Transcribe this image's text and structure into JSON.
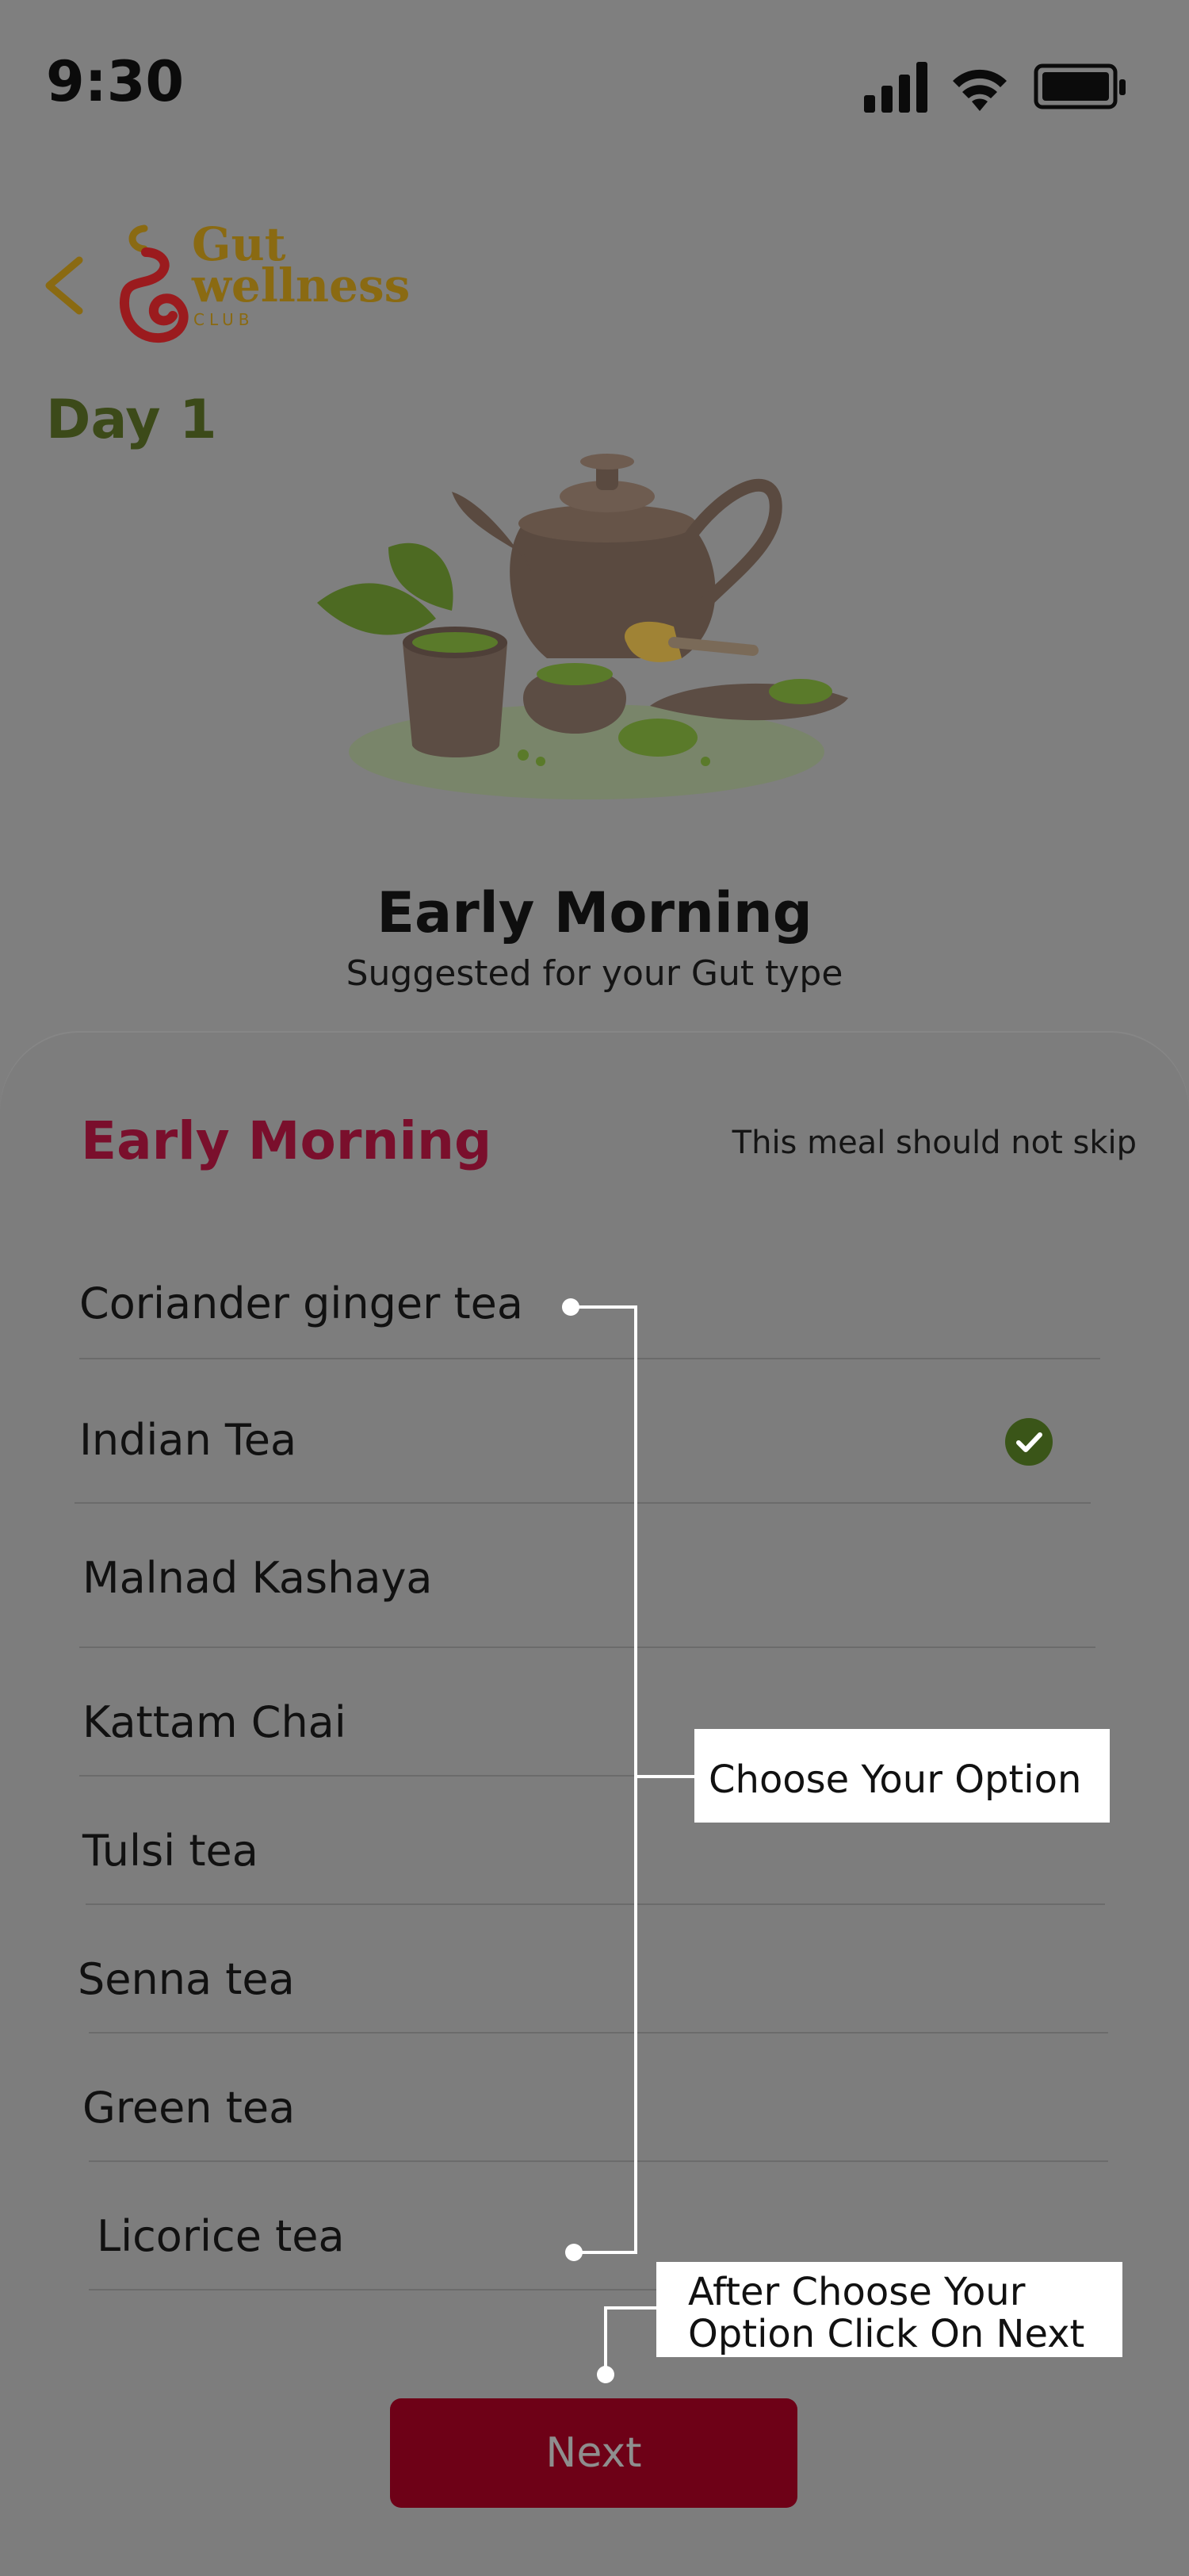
{
  "status_bar": {
    "time": "9:30"
  },
  "header": {
    "logo_text_1": "Gut",
    "logo_text_2": "wellness",
    "logo_text_3": "CLUB"
  },
  "day_label": "Day 1",
  "hero": {
    "title": "Early Morning",
    "subtitle": "Suggested for your Gut type"
  },
  "sheet": {
    "title": "Early Morning",
    "note": "This meal should not skip",
    "options": [
      {
        "label": "Coriander ginger tea",
        "selected": false
      },
      {
        "label": "Indian Tea",
        "selected": true
      },
      {
        "label": "Malnad Kashaya",
        "selected": false
      },
      {
        "label": "Kattam Chai",
        "selected": false
      },
      {
        "label": "Tulsi tea",
        "selected": false
      },
      {
        "label": "Senna tea",
        "selected": false
      },
      {
        "label": "Green tea",
        "selected": false
      },
      {
        "label": "Licorice tea",
        "selected": false
      }
    ]
  },
  "annotations": {
    "choose": "Choose Your Option",
    "next_hint_line_1": "After Choose Your",
    "next_hint_line_2": "Option Click On Next"
  },
  "next_button": {
    "label": "Next"
  },
  "colors": {
    "accent": "#7a0f2c",
    "button": "#6e0117",
    "day": "#3c4a19",
    "check": "#3a5518",
    "logo_gold": "#8a6a12",
    "logo_red": "#9b1b1e"
  },
  "icons": {
    "back": "chevron-left-icon",
    "selected": "check-circle-icon"
  }
}
